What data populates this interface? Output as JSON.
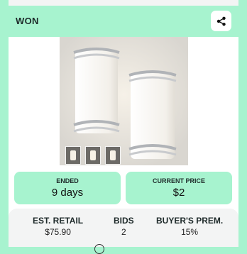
{
  "header": {
    "status": "WON",
    "share_icon": "share-icon"
  },
  "product": {
    "image_icon": "wall-sconce-image",
    "thumbnails": [
      "thumb-1",
      "thumb-2",
      "thumb-3"
    ]
  },
  "tiles": [
    {
      "label": "ENDED",
      "value": "9 days"
    },
    {
      "label": "CURRENT PRICE",
      "value": "$2"
    }
  ],
  "stats": [
    {
      "label": "EST. RETAIL",
      "value": "$75.90"
    },
    {
      "label": "BIDS",
      "value": "2"
    },
    {
      "label": "BUYER'S PREM.",
      "value": "15%"
    }
  ],
  "colors": {
    "accent": "#a7f3cf",
    "card": "#ffffff",
    "panel": "#f3f4f4"
  }
}
